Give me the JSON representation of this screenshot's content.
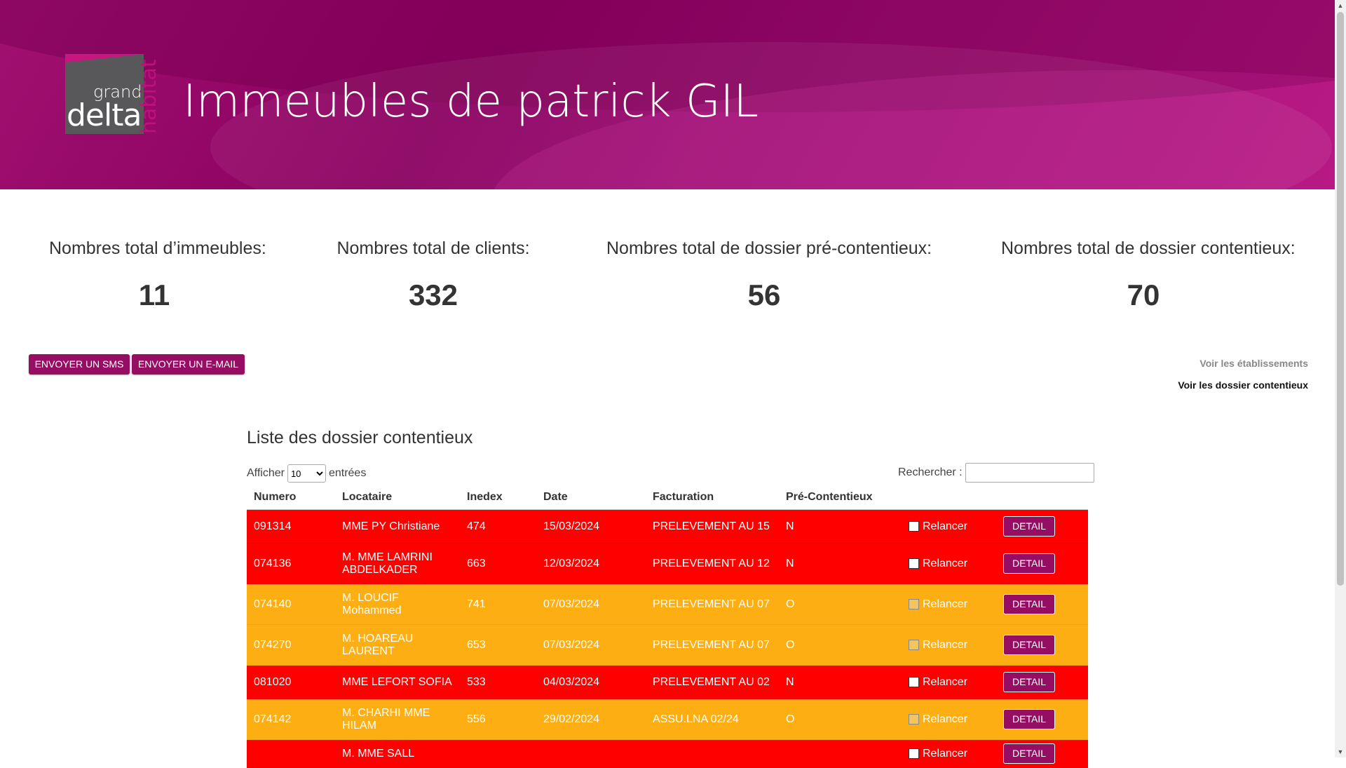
{
  "header": {
    "logo": {
      "grand": "grand",
      "delta": "delta",
      "habitat": "habitat"
    },
    "title": "Immeubles de patrick GIL"
  },
  "stats": [
    {
      "label": "Nombres total d’immeubles:",
      "value": "11"
    },
    {
      "label": "Nombres total de clients:",
      "value": "332"
    },
    {
      "label": "Nombres total de dossier pré-contentieux:",
      "value": "56"
    },
    {
      "label": "Nombres total de dossier contentieux:",
      "value": "70"
    }
  ],
  "actions": {
    "sms": "ENVOYER UN SMS",
    "email": "ENVOYER UN E-MAIL",
    "voir_etablissements": "Voir les établissements",
    "voir_contentieux": "Voir les dossier contentieux"
  },
  "list": {
    "title": "Liste des dossier contentieux",
    "show_prefix": "Afficher",
    "show_value": "10",
    "show_suffix": "entrées",
    "search_label": "Rechercher :",
    "search_value": "",
    "columns": [
      "Numero",
      "Locataire",
      "Inedex",
      "Date",
      "Facturation",
      "Pré-Contentieux"
    ],
    "relancer_label": "Relancer",
    "detail_label": "DETAIL",
    "rows": [
      {
        "numero": "091314",
        "locataire": "MME PY Christiane",
        "index": "474",
        "date": "15/03/2024",
        "facturation": "PRELEVEMENT AU 15",
        "pre": "N",
        "color": "#fe0000"
      },
      {
        "numero": "074136",
        "locataire": "M. MME LAMRINI ABDELKADER",
        "index": "663",
        "date": "12/03/2024",
        "facturation": "PRELEVEMENT AU 12",
        "pre": "N",
        "color": "#fe0000"
      },
      {
        "numero": "074140",
        "locataire": "M. LOUCIF Mohammed",
        "index": "741",
        "date": "07/03/2024",
        "facturation": "PRELEVEMENT AU 07",
        "pre": "O",
        "color": "#fcae12"
      },
      {
        "numero": "074270",
        "locataire": "M. HOAREAU LAURENT",
        "index": "653",
        "date": "07/03/2024",
        "facturation": "PRELEVEMENT AU 07",
        "pre": "O",
        "color": "#fcae12"
      },
      {
        "numero": "081020",
        "locataire": "MME LEFORT SOFIA",
        "index": "533",
        "date": "04/03/2024",
        "facturation": "PRELEVEMENT AU 02",
        "pre": "N",
        "color": "#fe0000"
      },
      {
        "numero": "074142",
        "locataire": "M. CHARHI MME HILAM",
        "index": "556",
        "date": "29/02/2024",
        "facturation": "ASSU.LNA 02/24",
        "pre": "O",
        "color": "#fcae12"
      },
      {
        "numero": "",
        "locataire": "M. MME SALL",
        "index": "",
        "date": "",
        "facturation": "",
        "pre": "",
        "color": "#fe0000"
      }
    ]
  },
  "colors": {
    "brand": "#960e64",
    "red_row": "#fe0000",
    "orange_row": "#fcae12"
  }
}
